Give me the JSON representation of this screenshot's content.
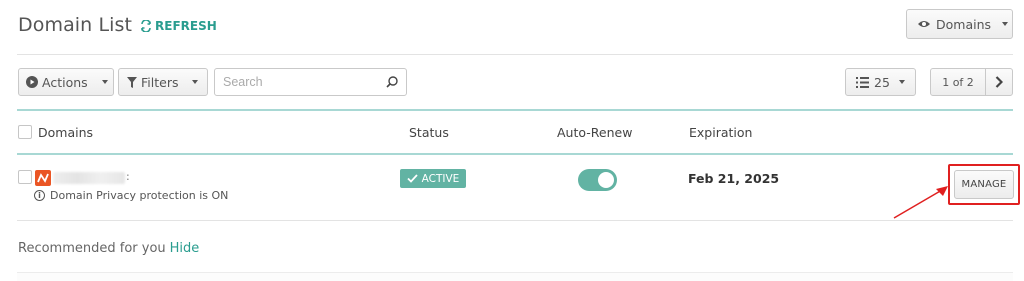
{
  "header": {
    "title": "Domain List",
    "refresh_label": "REFRESH",
    "view_dropdown_label": "Domains"
  },
  "toolbar": {
    "actions_label": "Actions",
    "filters_label": "Filters",
    "search_placeholder": "Search",
    "per_page_value": "25",
    "pagination_text": "1 of 2"
  },
  "table": {
    "columns": [
      "Domains",
      "Status",
      "Auto-Renew",
      "Expiration"
    ],
    "rows": [
      {
        "domain_visible_suffix": ":",
        "privacy_note": "Domain Privacy protection is ON",
        "status": "ACTIVE",
        "auto_renew": true,
        "expiration": "Feb 21, 2025",
        "action_label": "MANAGE"
      }
    ]
  },
  "recommended": {
    "label": "Recommended for you",
    "hide_label": "Hide"
  },
  "colors": {
    "accent": "#2a9d8f",
    "status_active": "#62b3a3",
    "highlight": "#e02020",
    "brand_logo": "#ea5524"
  },
  "icons": [
    "refresh-icon",
    "eye-icon",
    "play-circle-icon",
    "filter-icon",
    "search-icon",
    "list-icon",
    "chevron-right-icon",
    "check-icon",
    "info-icon",
    "namecheap-logo-icon"
  ]
}
